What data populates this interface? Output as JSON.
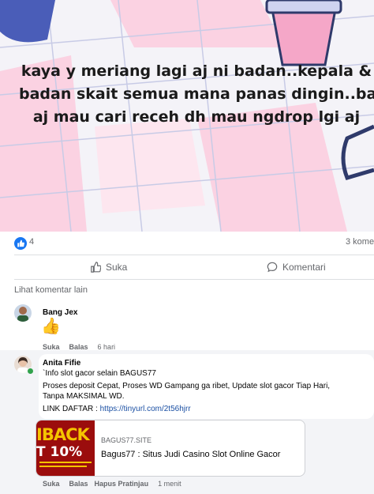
{
  "post": {
    "image_text_lines": [
      "kaya y meriang lagi aj ni badan..kepala &",
      "badan skait semua mana panas dingin..baru",
      "aj mau cari receh dh mau ngdrop lgi aj"
    ]
  },
  "stats": {
    "like_count": "4",
    "comment_count": "3 kome"
  },
  "actions": {
    "like_label": "Suka",
    "comment_label": "Komentari"
  },
  "more_comments_label": "Lihat komentar lain",
  "comments": [
    {
      "name": "Bang Jex",
      "content_emoji": "👍",
      "meta": {
        "like": "Suka",
        "reply": "Balas",
        "time": "6 hari"
      }
    },
    {
      "name": "Anita Fifie",
      "lines": [
        "`Info slot gacor selain BAGUS77",
        "Proses deposit Cepat, Proses WD Gampang ga ribet, Update slot gacor Tiap Hari,",
        "Tanpa MAKSIMAL WD."
      ],
      "link_prefix": "LINK DAFTAR : ",
      "link_url": "https://tinyurl.com/2t56hjrr",
      "preview": {
        "thumb_line1": "IBACK",
        "thumb_line2": "T 10%",
        "domain": "BAGUS77.SITE",
        "title": "Bagus77 : Situs Judi Casino Slot Online Gacor"
      },
      "meta": {
        "like": "Suka",
        "reply": "Balas",
        "hide": "Hapus Pratinjau",
        "time": "1 menit"
      }
    }
  ],
  "colors": {
    "facebook_blue": "#1877f2",
    "pink": "#f8b8d0",
    "online_green": "#31a24c"
  }
}
